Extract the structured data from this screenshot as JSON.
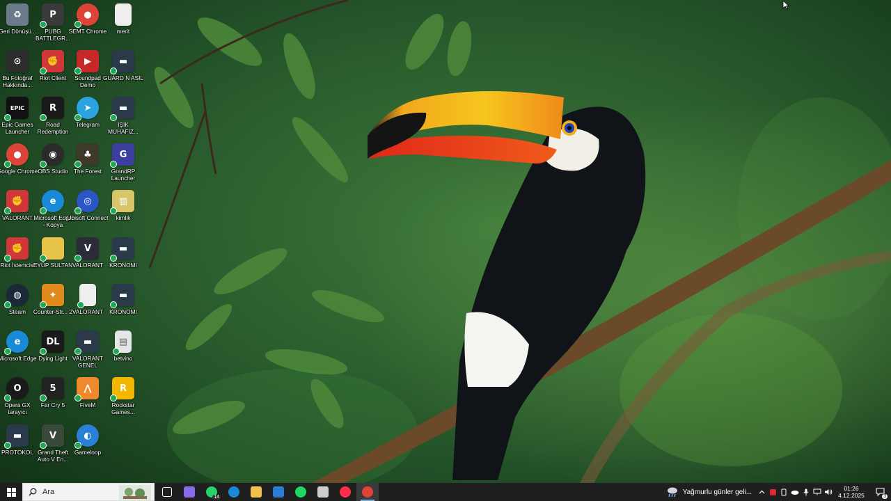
{
  "desktop_icons": [
    {
      "label": "Geri Dönüşü...",
      "icon": "recycle-bin-icon",
      "color": "#6b7b8c",
      "glyph": "♻"
    },
    {
      "label": "PUBG BATTLEGR...",
      "icon": "pubg-icon",
      "color": "#3a3a3a",
      "glyph": "P"
    },
    {
      "label": "SEMT Chrome",
      "icon": "chrome-icon",
      "color": "#db4437",
      "glyph": "●"
    },
    {
      "label": "merit",
      "icon": "file-icon",
      "color": "#eeeeee",
      "glyph": ""
    },
    {
      "label": "Bu Fotoğraf Hakkında...",
      "icon": "camera-icon",
      "color": "#2d2d2d",
      "glyph": "⊙"
    },
    {
      "label": "Riot Client",
      "icon": "riot-client-icon",
      "color": "#d13639",
      "glyph": "✊"
    },
    {
      "label": "Soundpad Demo",
      "icon": "soundpad-icon",
      "color": "#c62828",
      "glyph": "▶"
    },
    {
      "label": "GUARD N ASIL",
      "icon": "shortcut-app-icon",
      "color": "#2b3a4a",
      "glyph": "▬"
    },
    {
      "label": "Epic Games Launcher",
      "icon": "epic-games-icon",
      "color": "#111111",
      "glyph": "EPIC"
    },
    {
      "label": "Road Redemption",
      "icon": "road-redemption-icon",
      "color": "#1a1a1a",
      "glyph": "R"
    },
    {
      "label": "Telegram",
      "icon": "telegram-icon",
      "color": "#2aa3e0",
      "glyph": "➤"
    },
    {
      "label": "IŞIK MUHAFIZ...",
      "icon": "shortcut-app-icon",
      "color": "#2b3a4a",
      "glyph": "▬"
    },
    {
      "label": "Google Chrome",
      "icon": "chrome-icon",
      "color": "#db4437",
      "glyph": "●"
    },
    {
      "label": "OBS Studio",
      "icon": "obs-icon",
      "color": "#2b2b2b",
      "glyph": "◉"
    },
    {
      "label": "The Forest",
      "icon": "the-forest-icon",
      "color": "#3d3a2a",
      "glyph": "♣"
    },
    {
      "label": "GrandRP Launcher",
      "icon": "grandrp-icon",
      "color": "#3b3e9e",
      "glyph": "G"
    },
    {
      "label": "VALORANT",
      "icon": "riot-icon",
      "color": "#d13639",
      "glyph": "✊"
    },
    {
      "label": "Microsoft Edge - Kopya",
      "icon": "edge-icon",
      "color": "#1a8ad6",
      "glyph": "e"
    },
    {
      "label": "Ubisoft Connect",
      "icon": "ubisoft-icon",
      "color": "#2a56c6",
      "glyph": "◎"
    },
    {
      "label": "kimlik",
      "icon": "archive-icon",
      "color": "#d9c46a",
      "glyph": "▥"
    },
    {
      "label": "Riot İstemcisi",
      "icon": "riot-icon",
      "color": "#d13639",
      "glyph": "✊"
    },
    {
      "label": "EYÜP SULTAN",
      "icon": "folder-icon",
      "color": "#e8c34a",
      "glyph": ""
    },
    {
      "label": "VALORANT",
      "icon": "valorant-icon",
      "color": "#2b2b3a",
      "glyph": "V"
    },
    {
      "label": "KRONOMI",
      "icon": "shortcut-app-icon",
      "color": "#2b3a4a",
      "glyph": "▬"
    },
    {
      "label": "Steam",
      "icon": "steam-icon",
      "color": "#1b2838",
      "glyph": "◍"
    },
    {
      "label": "Counter-Str... 2",
      "icon": "counter-strike-icon",
      "color": "#e08a1e",
      "glyph": "✦"
    },
    {
      "label": "VALORANT",
      "icon": "file-icon",
      "color": "#eeeeee",
      "glyph": ""
    },
    {
      "label": "KRONOMI",
      "icon": "shortcut-app-icon",
      "color": "#2b3a4a",
      "glyph": "▬"
    },
    {
      "label": "Microsoft Edge",
      "icon": "edge-icon",
      "color": "#1a8ad6",
      "glyph": "e"
    },
    {
      "label": "Dying Light",
      "icon": "dying-light-icon",
      "color": "#1a1a1a",
      "glyph": "DL"
    },
    {
      "label": "VALORANT GENEL",
      "icon": "shortcut-app-icon",
      "color": "#2b3a4a",
      "glyph": "▬"
    },
    {
      "label": "betvino",
      "icon": "image-file-icon",
      "color": "#e6e6e6",
      "glyph": "▤"
    },
    {
      "label": "Opera GX tarayıcı",
      "icon": "opera-gx-icon",
      "color": "#1a1a1a",
      "glyph": "O"
    },
    {
      "label": "Far Cry 5",
      "icon": "far-cry-icon",
      "color": "#222222",
      "glyph": "5"
    },
    {
      "label": "FiveM",
      "icon": "fivem-icon",
      "color": "#f0892b",
      "glyph": "⋀"
    },
    {
      "label": "Rockstar Games...",
      "icon": "rockstar-icon",
      "color": "#f3b700",
      "glyph": "R"
    },
    {
      "label": "PROTOKOL",
      "icon": "shortcut-app-icon",
      "color": "#2b3a4a",
      "glyph": "▬"
    },
    {
      "label": "Grand Theft Auto V En...",
      "icon": "gta-icon",
      "color": "#3a4a3a",
      "glyph": "V"
    },
    {
      "label": "Gameloop",
      "icon": "gameloop-icon",
      "color": "#2a7fd6",
      "glyph": "◐"
    }
  ],
  "taskbar": {
    "search_placeholder": "Ara",
    "apps": [
      {
        "name": "task-view-icon",
        "color": "#ffffff"
      },
      {
        "name": "copilot-icon",
        "color": "#8a6ce8"
      },
      {
        "name": "whatsapp-icon",
        "color": "#25d366",
        "badge": "14"
      },
      {
        "name": "edge-icon",
        "color": "#1a8ad6"
      },
      {
        "name": "file-explorer-icon",
        "color": "#f0c24b"
      },
      {
        "name": "outlook-icon",
        "color": "#2b7cd3"
      },
      {
        "name": "spotify-icon",
        "color": "#1ed760"
      },
      {
        "name": "app-icon",
        "color": "#cccccc"
      },
      {
        "name": "opera-gx-icon",
        "color": "#ff2e4d"
      },
      {
        "name": "chrome-icon",
        "color": "#db4437",
        "active": true
      }
    ],
    "weather_text": "Yağmurlu günler geli...",
    "time": "01:26",
    "date": "4.12.2025",
    "notification_count": "3"
  }
}
